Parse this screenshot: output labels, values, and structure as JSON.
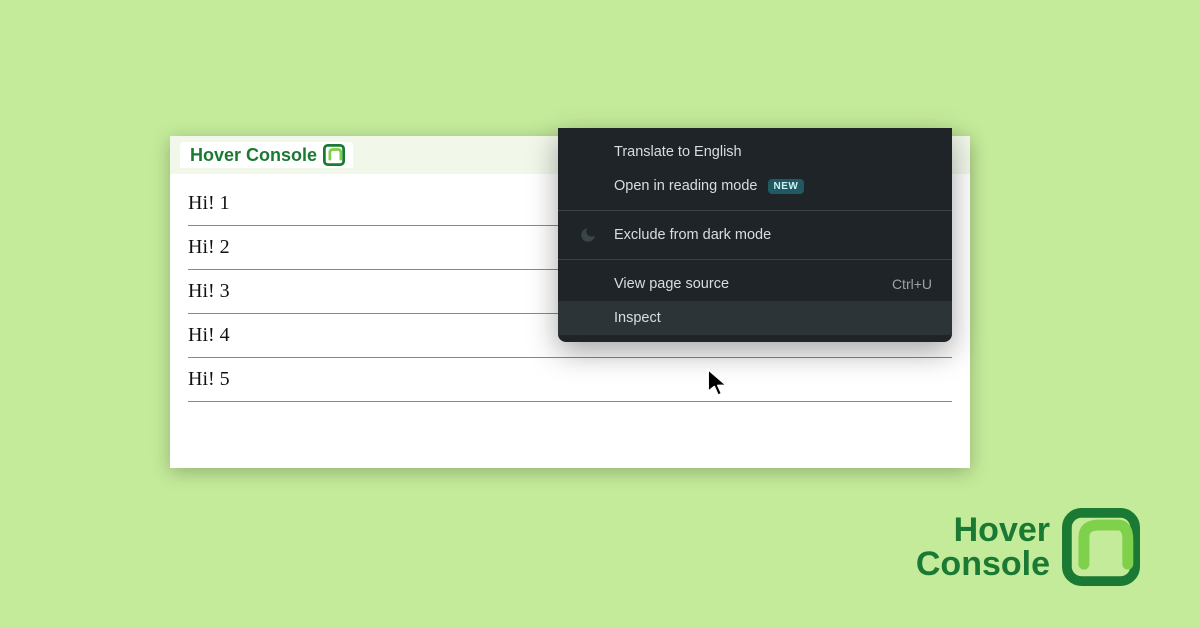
{
  "tab": {
    "title": "Hover Console"
  },
  "list": {
    "items": [
      {
        "text": "Hi! 1"
      },
      {
        "text": "Hi! 2"
      },
      {
        "text": "Hi! 3"
      },
      {
        "text": "Hi! 4"
      },
      {
        "text": "Hi! 5"
      }
    ]
  },
  "context_menu": {
    "translate": "Translate to English",
    "reading_mode": "Open in reading mode",
    "reading_mode_badge": "NEW",
    "exclude_dark": "Exclude from dark mode",
    "view_source": "View page source",
    "view_source_shortcut": "Ctrl+U",
    "inspect": "Inspect"
  },
  "brand": {
    "line1": "Hover",
    "line2": "Console"
  },
  "colors": {
    "bg": "#c4eb9a",
    "brand_green": "#1a7a33",
    "menu_bg": "#1e2427"
  }
}
